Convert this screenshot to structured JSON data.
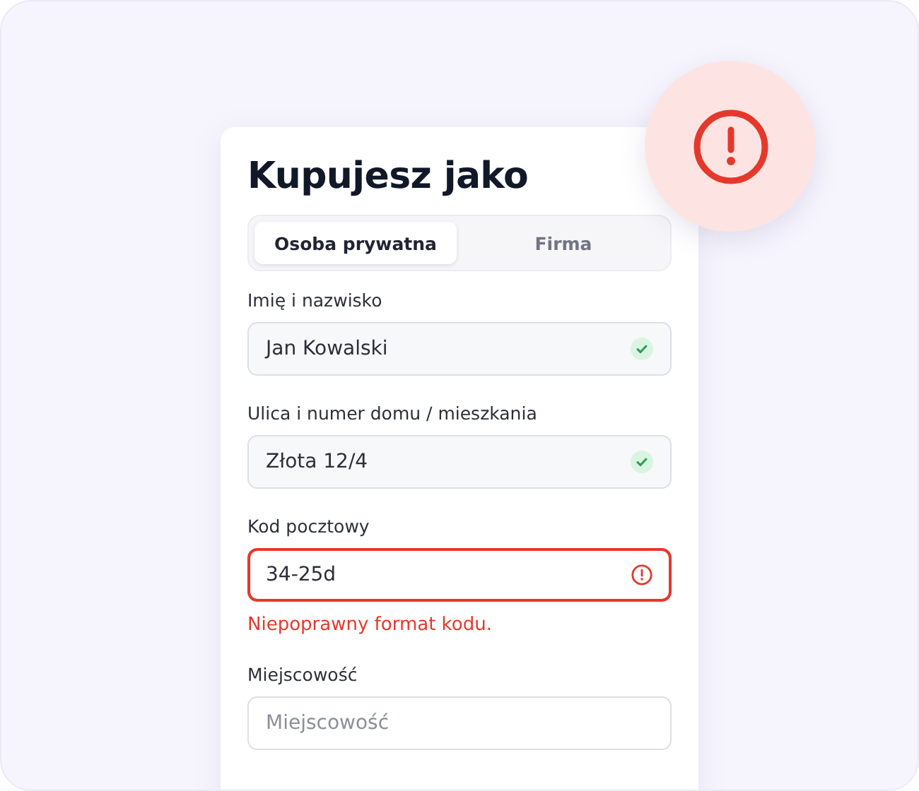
{
  "alert_badge": {
    "kind": "error"
  },
  "form": {
    "title": "Kupujesz jako",
    "tabs": [
      {
        "label": "Osoba prywatna",
        "selected": true
      },
      {
        "label": "Firma",
        "selected": false
      }
    ],
    "fields": [
      {
        "label": "Imię i nazwisko",
        "value": "Jan Kowalski",
        "kind": "valid"
      },
      {
        "label": "Ulica i numer domu / mieszkania",
        "value": "Złota 12/4",
        "kind": "valid"
      },
      {
        "label": "Kod pocztowy",
        "value": "34-25d",
        "kind": "error",
        "error": "Niepoprawny format kodu."
      },
      {
        "label": "Miejscowość",
        "placeholder": "Miejscowość",
        "kind": "empty"
      }
    ]
  }
}
